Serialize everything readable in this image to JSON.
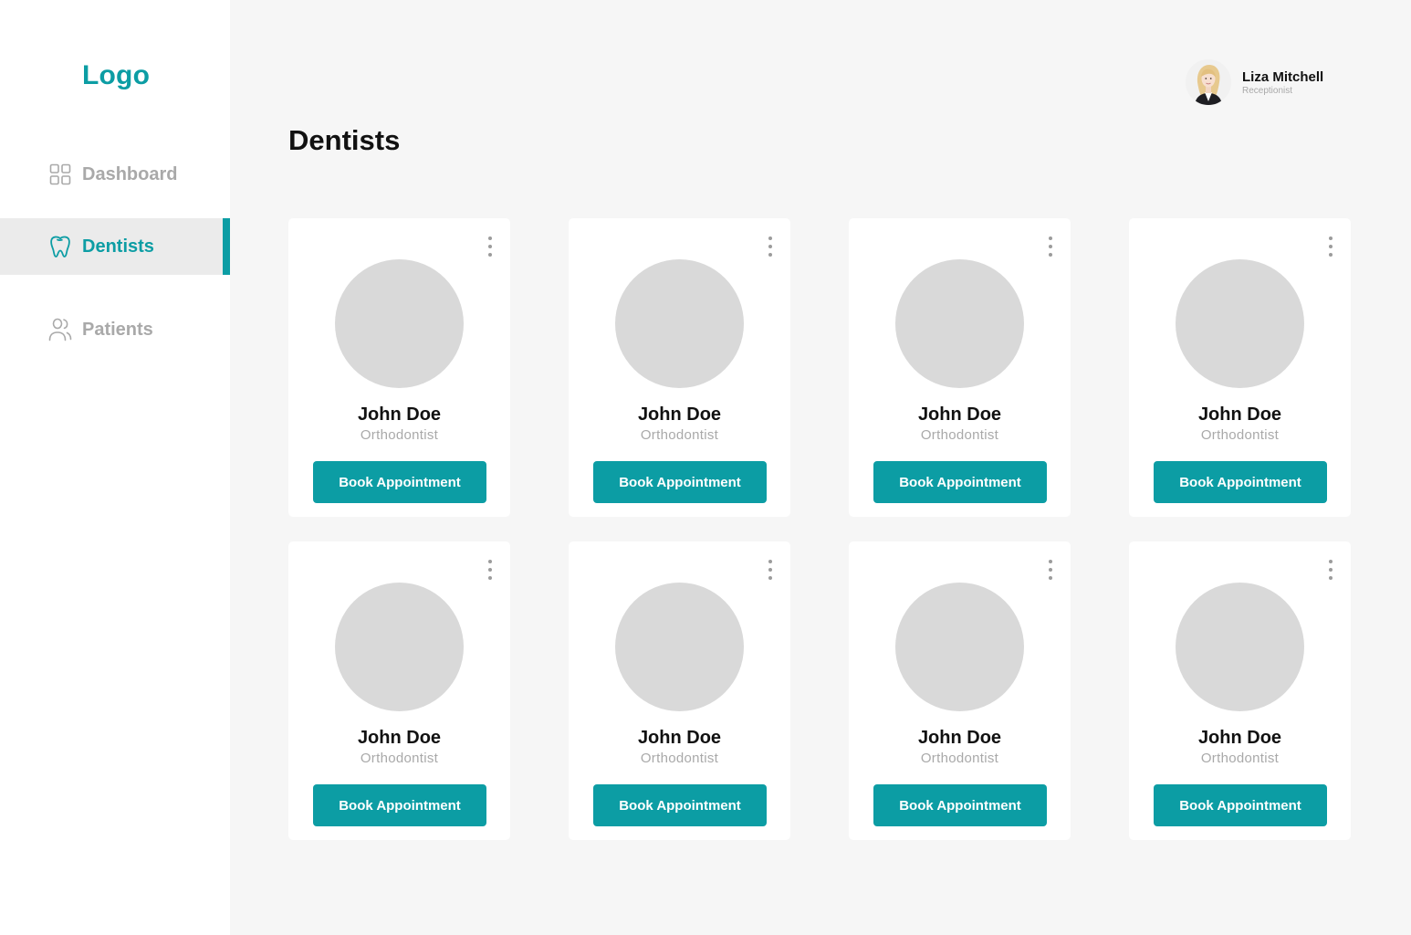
{
  "brand": {
    "logo_text": "Logo",
    "accent_color": "#0c9da4"
  },
  "sidebar": {
    "items": [
      {
        "label": "Dashboard",
        "icon": "dashboard-grid-icon",
        "active": false
      },
      {
        "label": "Dentists",
        "icon": "tooth-icon",
        "active": true
      },
      {
        "label": "Patients",
        "icon": "users-icon",
        "active": false
      }
    ]
  },
  "header": {
    "user": {
      "name": "Liza Mitchell",
      "role": "Receptionist",
      "avatar_icon": "user-avatar"
    }
  },
  "main": {
    "title": "Dentists",
    "dentists": [
      {
        "name": "John Doe",
        "specialty": "Orthodontist",
        "button_label": "Book Appointment"
      },
      {
        "name": "John Doe",
        "specialty": "Orthodontist",
        "button_label": "Book Appointment"
      },
      {
        "name": "John Doe",
        "specialty": "Orthodontist",
        "button_label": "Book Appointment"
      },
      {
        "name": "John Doe",
        "specialty": "Orthodontist",
        "button_label": "Book Appointment"
      },
      {
        "name": "John Doe",
        "specialty": "Orthodontist",
        "button_label": "Book Appointment"
      },
      {
        "name": "John Doe",
        "specialty": "Orthodontist",
        "button_label": "Book Appointment"
      },
      {
        "name": "John Doe",
        "specialty": "Orthodontist",
        "button_label": "Book Appointment"
      },
      {
        "name": "John Doe",
        "specialty": "Orthodontist",
        "button_label": "Book Appointment"
      }
    ]
  }
}
